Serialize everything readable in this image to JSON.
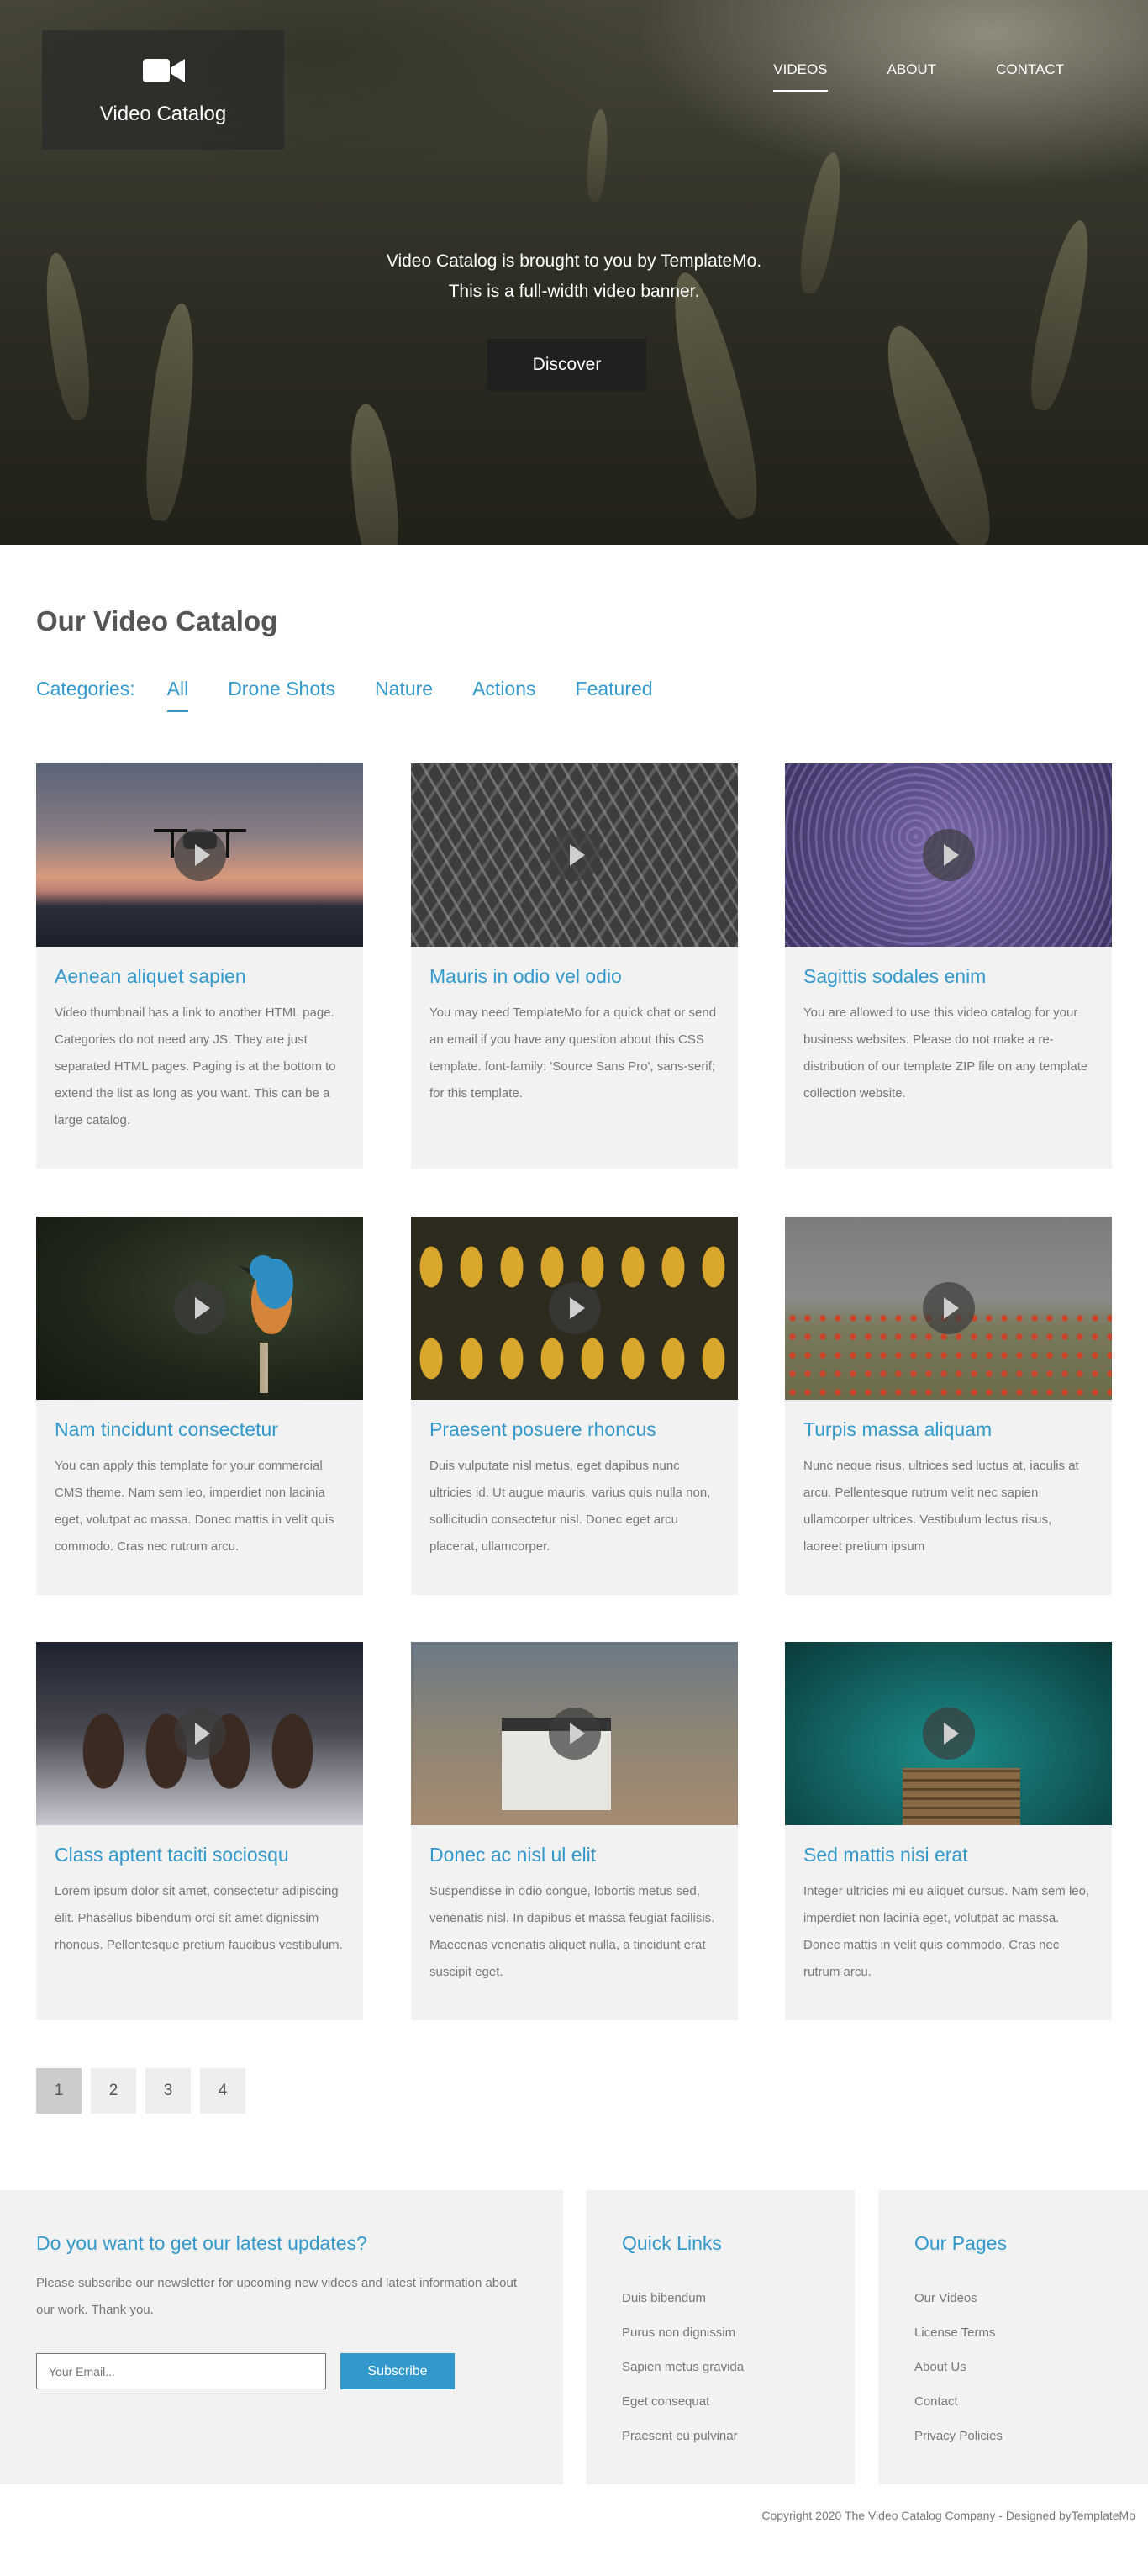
{
  "brand": {
    "title": "Video Catalog"
  },
  "nav": [
    "VIDEOS",
    "ABOUT",
    "CONTACT"
  ],
  "hero": {
    "line1": "Video Catalog is brought to you by TemplateMo.",
    "line2": "This is a full-width video banner.",
    "button": "Discover"
  },
  "catalog": {
    "heading": "Our Video Catalog",
    "categories_label": "Categories:",
    "categories": [
      "All",
      "Drone Shots",
      "Nature",
      "Actions",
      "Featured"
    ],
    "videos": [
      {
        "title": "Aenean aliquet sapien",
        "text": "Video thumbnail has a link to another HTML page. Categories do not need any JS. They are just separated HTML pages. Paging is at the bottom to extend the list as long as you want. This can be a large catalog."
      },
      {
        "title": "Mauris in odio vel odio",
        "text": "You may need TemplateMo for a quick chat or send an email if you have any question about this CSS template. font-family: 'Source Sans Pro', sans-serif; for this template."
      },
      {
        "title": "Sagittis sodales enim",
        "text": "You are allowed to use this video catalog for your business websites. Please do not make a re-distribution of our template ZIP file on any template collection website."
      },
      {
        "title": "Nam tincidunt consectetur",
        "text": "You can apply this template for your commercial CMS theme. Nam sem leo, imperdiet non lacinia eget, volutpat ac massa. Donec mattis in velit quis commodo. Cras nec rutrum arcu."
      },
      {
        "title": "Praesent posuere rhoncus",
        "text": "Duis vulputate nisl metus, eget dapibus nunc ultricies id. Ut augue mauris, varius quis nulla non, sollicitudin consectetur nisl. Donec eget arcu placerat, ullamcorper."
      },
      {
        "title": "Turpis massa aliquam",
        "text": "Nunc neque risus, ultrices sed luctus at, iaculis at arcu. Pellentesque rutrum velit nec sapien ullamcorper ultrices. Vestibulum lectus risus, laoreet pretium ipsum"
      },
      {
        "title": "Class aptent taciti sociosqu",
        "text": "Lorem ipsum dolor sit amet, consectetur adipiscing elit. Phasellus bibendum orci sit amet dignissim rhoncus. Pellentesque pretium faucibus vestibulum."
      },
      {
        "title": "Donec ac nisl ul elit",
        "text": "Suspendisse in odio congue, lobortis metus sed, venenatis nisl. In dapibus et massa feugiat facilisis. Maecenas venenatis aliquet nulla, a tincidunt erat suscipit eget."
      },
      {
        "title": "Sed mattis nisi erat",
        "text": "Integer ultricies mi eu aliquet cursus. Nam sem leo, imperdiet non lacinia eget, volutpat ac massa. Donec mattis in velit quis commodo. Cras nec rutrum arcu."
      }
    ]
  },
  "pagination": [
    "1",
    "2",
    "3",
    "4"
  ],
  "footer": {
    "newsletter": {
      "heading": "Do you want to get our latest updates?",
      "text": "Please subscribe our newsletter for upcoming new videos and latest information about our work. Thank you.",
      "placeholder": "Your Email...",
      "button": "Subscribe"
    },
    "quick_links": {
      "heading": "Quick Links",
      "items": [
        "Duis bibendum",
        "Purus non dignissim",
        "Sapien metus gravida",
        "Eget consequat",
        "Praesent eu pulvinar"
      ]
    },
    "pages": {
      "heading": "Our Pages",
      "items": [
        "Our Videos",
        "License Terms",
        "About Us",
        "Contact",
        "Privacy Policies"
      ]
    },
    "copyright": "Copyright 2020 The Video Catalog Company - Designed byTemplateMo"
  },
  "colors": {
    "accent": "#3399cc",
    "panel": "#f2f2f2"
  }
}
